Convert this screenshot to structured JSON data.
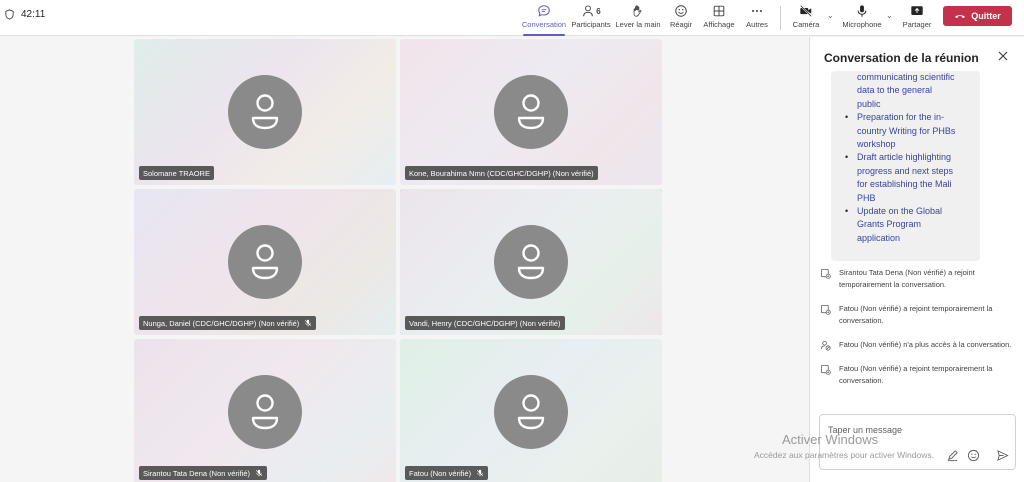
{
  "meeting": {
    "elapsed": "42:11"
  },
  "toolbar": {
    "conversation": "Conversation",
    "participants": "Participants",
    "participants_count": "6",
    "raise_hand": "Lever la main",
    "react": "Réagir",
    "view": "Affichage",
    "more": "Autres",
    "camera": "Caméra",
    "microphone": "Microphone",
    "share": "Partager",
    "leave": "Quitter"
  },
  "tiles": [
    {
      "name": "Solomane TRAORE",
      "muted": false
    },
    {
      "name": "Kone, Bourahima Nmn (CDC/GHC/DGHP) (Non vérifié)",
      "muted": false
    },
    {
      "name": "Nunga, Daniel (CDC/GHC/DGHP) (Non vérifié)",
      "muted": true
    },
    {
      "name": "Vandi, Henry (CDC/GHC/DGHP) (Non vérifié)",
      "muted": false,
      "speaking": true
    },
    {
      "name": "Sirantou Tata Dena (Non vérifié)",
      "muted": true
    },
    {
      "name": "Fatou (Non vérifié)",
      "muted": true
    }
  ],
  "chat": {
    "title": "Conversation de la réunion",
    "message_items": [
      {
        "text": "communicating scientific",
        "cont": true
      },
      {
        "text": "data to the general",
        "cont": true
      },
      {
        "text": "public",
        "cont": true
      },
      {
        "text": "Preparation for the in-",
        "cont": false
      },
      {
        "text": "country Writing for PHBs",
        "cont": true
      },
      {
        "text": "workshop",
        "cont": true
      },
      {
        "text": "Draft article highlighting",
        "cont": false
      },
      {
        "text": "progress and next steps",
        "cont": true
      },
      {
        "text": "for establishing the Mali",
        "cont": true
      },
      {
        "text": "PHB",
        "cont": true
      },
      {
        "text": "Update on the Global",
        "cont": false
      },
      {
        "text": "Grants Program",
        "cont": true
      },
      {
        "text": "application",
        "cont": true
      }
    ],
    "events": [
      {
        "icon": "join-chat-icon",
        "text": "Sirantou Tata Dena (Non vérifié) a rejoint temporairement la conversation."
      },
      {
        "icon": "join-chat-icon",
        "text": "Fatou (Non vérifié) a rejoint temporairement la conversation."
      },
      {
        "icon": "no-access-icon",
        "text": "Fatou (Non vérifié) n'a plus accès à la conversation."
      },
      {
        "icon": "join-chat-icon",
        "text": "Fatou (Non vérifié) a rejoint temporairement la conversation."
      }
    ],
    "composer_placeholder": "Taper un message"
  },
  "watermark": {
    "line1": "Activer Windows",
    "line2": "Accédez aux paramètres pour activer Windows."
  },
  "colors": {
    "accent": "#5b5fc7",
    "leave": "#c4314b",
    "link": "#3a44a4"
  }
}
